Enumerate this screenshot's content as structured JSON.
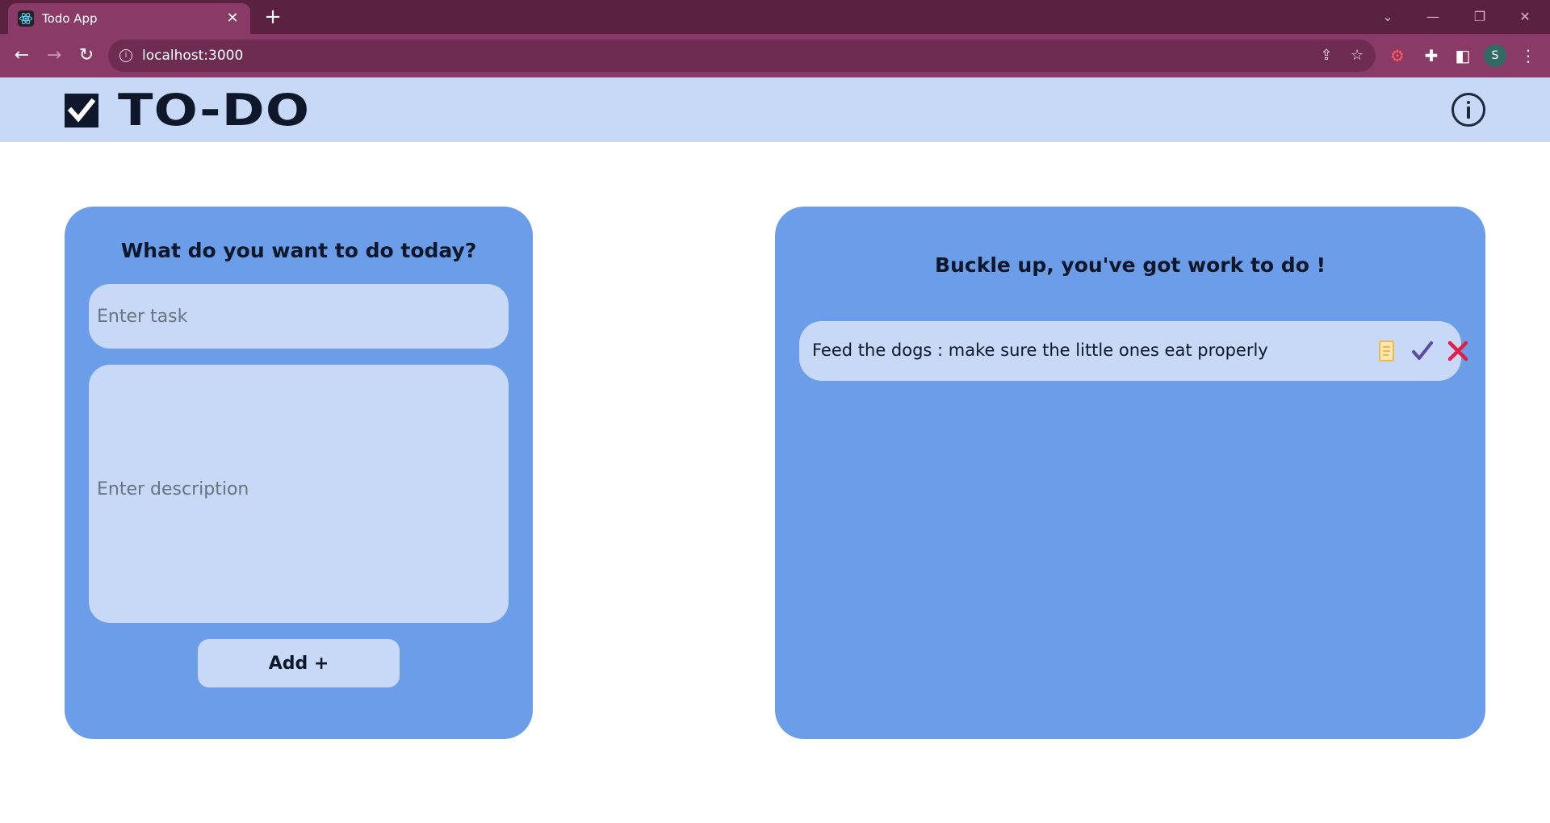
{
  "browser": {
    "tab_title": "Todo App",
    "url": "localhost:3000",
    "profile_initial": "S"
  },
  "header": {
    "logo_text": "TO-DO"
  },
  "form": {
    "heading": "What do you want to do today?",
    "task_placeholder": "Enter task",
    "description_placeholder": "Enter description",
    "add_label": "Add +"
  },
  "list": {
    "heading": "Buckle up, you've got work to do !",
    "items": [
      {
        "text": "Feed the dogs : make sure the little ones eat properly"
      }
    ]
  },
  "colors": {
    "header_bg": "#c7d9f7",
    "card_bg": "#6b9de8",
    "input_bg": "#c7d9f7",
    "text": "#0f172a",
    "check_icon": "#5b4aa0",
    "delete_icon": "#e11d48",
    "notes_icon": "#f6b547"
  }
}
